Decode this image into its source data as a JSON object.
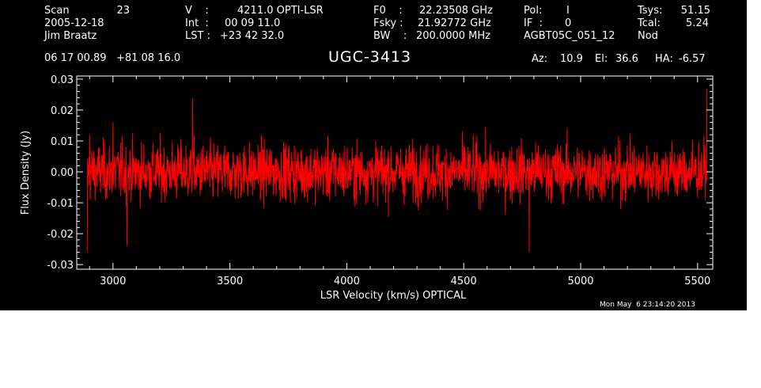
{
  "header": {
    "scan_label": "Scan",
    "scan_value": "23",
    "date": "2005-12-18",
    "observer": "Jim Braatz",
    "coords": "06 17 00.89   +81 08 16.0",
    "v_label": "V    :",
    "v_value": "4211.0 OPTI-LSR",
    "int_label": "Int  :",
    "int_value": "00 09 11.0",
    "lst_label": "LST :",
    "lst_value": "+23 42 32.0",
    "f0_label": "F0    :",
    "f0_value": "22.23508 GHz",
    "fsky_label": "Fsky :",
    "fsky_value": "21.92772 GHz",
    "bw_label": "BW    :",
    "bw_value": "200.0000 MHz",
    "pol_label": "Pol:",
    "pol_value": "I",
    "if_label": "IF  :",
    "if_value": "0",
    "project": "AGBT05C_051_12",
    "tsys_label": "Tsys:",
    "tsys_value": "51.15",
    "tcal_label": "Tcal:",
    "tcal_value": "5.24",
    "mode": "Nod",
    "az_label": "Az:",
    "az_value": "10.9",
    "el_label": "El:",
    "el_value": "36.6",
    "ha_label": "HA:",
    "ha_value": "-6.57"
  },
  "footer": {
    "timestamp": "Mon May  6 23:14:20 2013"
  },
  "colors": {
    "background": "#000000",
    "axes": "#ffffff",
    "spectrum": "#ff0000",
    "outside": "#ffffff"
  },
  "chart_data": {
    "type": "line",
    "title": "UGC-3413",
    "xlabel": "LSR Velocity (km/s) OPTICAL",
    "ylabel": "Flux Density (Jy)",
    "xlim": [
      2845,
      5565
    ],
    "ylim": [
      -0.0315,
      0.031
    ],
    "xticks": [
      3000,
      3500,
      4000,
      4500,
      5000,
      5500
    ],
    "xtick_labels": [
      "3000",
      "3500",
      "4000",
      "4500",
      "5000",
      "5500"
    ],
    "yticks": [
      -0.03,
      -0.02,
      -0.01,
      0.0,
      0.01,
      0.02,
      0.03
    ],
    "ytick_labels": [
      "-0.03",
      "-0.02",
      "-0.01",
      "0.00",
      "0.01",
      "0.02",
      "0.03"
    ],
    "grid": false,
    "legend": "none",
    "series": [
      {
        "x_range": [
          2890,
          5540
        ],
        "points": 2048,
        "noise_rms": 0.0065,
        "mean": 0.0,
        "values_approx": [
          [
            2890,
            -0.026
          ],
          [
            2900,
            0.012
          ],
          [
            3000,
            0.016
          ],
          [
            3060,
            -0.024
          ],
          [
            3340,
            0.024
          ],
          [
            4780,
            -0.026
          ],
          [
            5540,
            0.027
          ]
        ]
      }
    ]
  }
}
